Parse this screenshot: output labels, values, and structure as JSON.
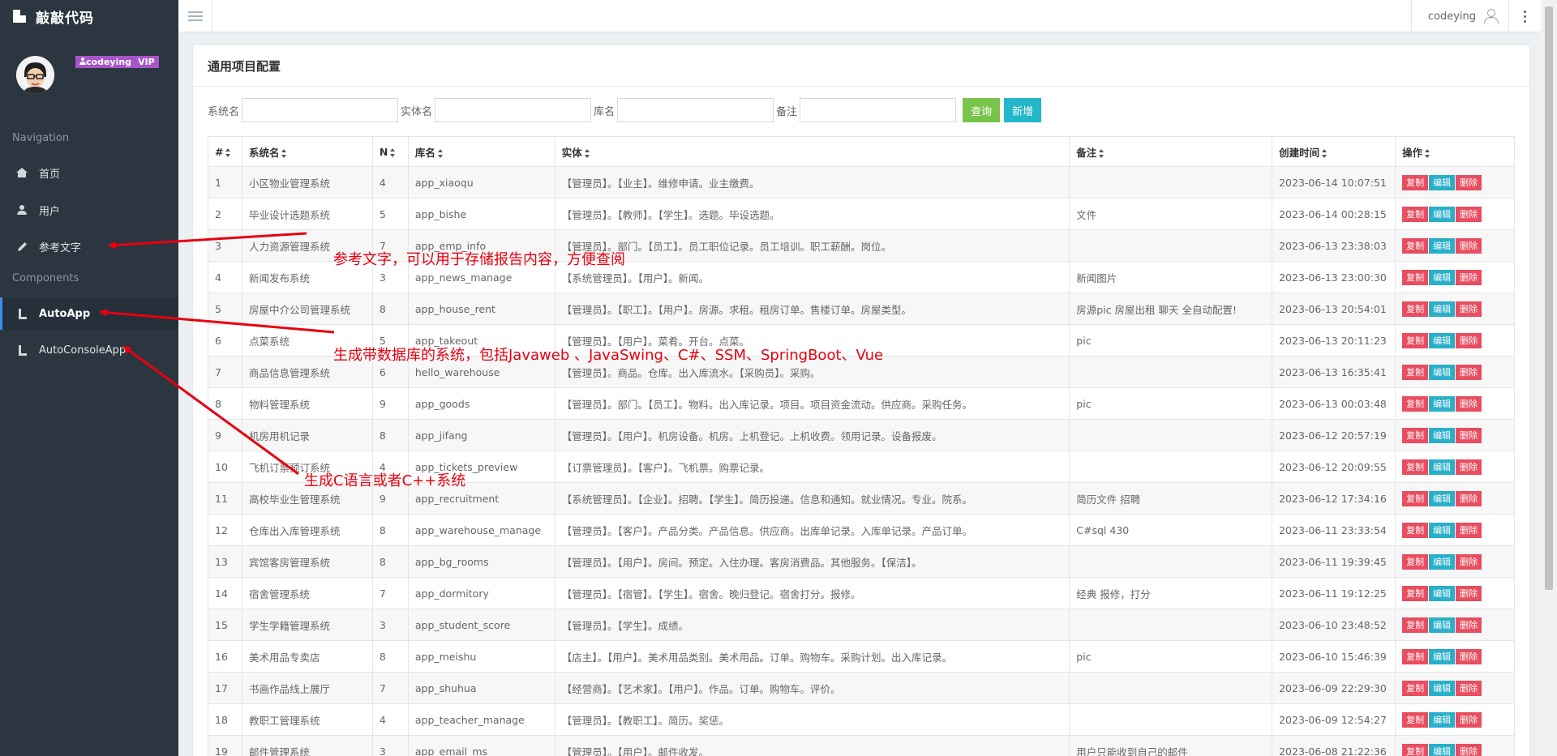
{
  "brand": {
    "title": "敲敲代码"
  },
  "profile": {
    "username": "codeying",
    "badge_tag": "VIP"
  },
  "sidebar": {
    "section_navigation": "Navigation",
    "section_components": "Components",
    "items": [
      {
        "label": "首页",
        "icon": "home-icon"
      },
      {
        "label": "用户",
        "icon": "user-icon"
      },
      {
        "label": "参考文字",
        "icon": "pencil-icon"
      },
      {
        "label": "AutoApp",
        "icon": "boot-icon",
        "active": true
      },
      {
        "label": "AutoConsoleApp",
        "icon": "boot-icon"
      }
    ]
  },
  "topbar": {
    "username": "codeying"
  },
  "panel": {
    "title": "通用项目配置"
  },
  "filter": {
    "system_label": "系统名",
    "entity_label": "实体名",
    "db_label": "库名",
    "remark_label": "备注",
    "query_button": "查询",
    "add_button": "新增"
  },
  "table": {
    "headers": [
      "#",
      "系统名",
      "N",
      "库名",
      "实体",
      "备注",
      "创建时间",
      "操作"
    ],
    "actions": {
      "copy": "复制",
      "edit": "编辑",
      "delete": "删除"
    },
    "rows": [
      [
        "1",
        "小区物业管理系统",
        "4",
        "app_xiaoqu",
        "【管理员】。【业主】。维修申请。业主缴费。",
        "",
        "2023-06-14 10:07:51"
      ],
      [
        "2",
        "毕业设计选题系统",
        "5",
        "app_bishe",
        "【管理员】。【教师】。【学生】。选题。毕设选题。",
        "文件",
        "2023-06-14 00:28:15"
      ],
      [
        "3",
        "人力资源管理系统",
        "7",
        "app_emp_info",
        "【管理员】。部门。【员工】。员工职位记录。员工培训。职工薪酬。岗位。",
        "",
        "2023-06-13 23:38:03"
      ],
      [
        "4",
        "新闻发布系统",
        "3",
        "app_news_manage",
        "【系统管理员】。【用户】。新闻。",
        "新闻图片",
        "2023-06-13 23:00:30"
      ],
      [
        "5",
        "房屋中介公司管理系统",
        "8",
        "app_house_rent",
        "【管理员】。【职工】。【用户】。房源。求租。租房订单。售楼订单。房屋类型。",
        "房源pic 房屋出租 聊天 全自动配置!",
        "2023-06-13 20:54:01"
      ],
      [
        "6",
        "点菜系统",
        "5",
        "app_takeout",
        "【管理员】。【用户】。菜肴。开台。点菜。",
        "pic",
        "2023-06-13 20:11:23"
      ],
      [
        "7",
        "商品信息管理系统",
        "6",
        "hello_warehouse",
        "【管理员】。商品。仓库。出入库流水。【采购员】。采购。",
        "",
        "2023-06-13 16:35:41"
      ],
      [
        "8",
        "物料管理系统",
        "9",
        "app_goods",
        "【管理员】。部门。【员工】。物料。出入库记录。项目。项目资金流动。供应商。采购任务。",
        "pic",
        "2023-06-13 00:03:48"
      ],
      [
        "9",
        "机房用机记录",
        "8",
        "app_jifang",
        "【管理员】。【用户】。机房设备。机房。上机登记。上机收费。领用记录。设备报废。",
        "",
        "2023-06-12 20:57:19"
      ],
      [
        "10",
        "飞机订票预订系统",
        "4",
        "app_tickets_preview",
        "【订票管理员】。【客户】。飞机票。购票记录。",
        "",
        "2023-06-12 20:09:55"
      ],
      [
        "11",
        "高校毕业生管理系统",
        "9",
        "app_recruitment",
        "【系统管理员】。【企业】。招聘。【学生】。简历投递。信息和通知。就业情况。专业。院系。",
        "简历文件 招聘",
        "2023-06-12 17:34:16"
      ],
      [
        "12",
        "仓库出入库管理系统",
        "8",
        "app_warehouse_manage",
        "【管理员】。【客户】。产品分类。产品信息。供应商。出库单记录。入库单记录。产品订单。",
        "C#sql 430",
        "2023-06-11 23:33:54"
      ],
      [
        "13",
        "宾馆客房管理系统",
        "8",
        "app_bg_rooms",
        "【管理员】。【用户】。房间。预定。入住办理。客房消费品。其他服务。【保洁】。",
        "",
        "2023-06-11 19:39:45"
      ],
      [
        "14",
        "宿舍管理系统",
        "7",
        "app_dormitory",
        "【管理员】。【宿管】。【学生】。宿舍。晚归登记。宿舍打分。报修。",
        "经典 报修，打分",
        "2023-06-11 19:12:25"
      ],
      [
        "15",
        "学生学籍管理系统",
        "3",
        "app_student_score",
        "【管理员】。【学生】。成绩。",
        "",
        "2023-06-10 23:48:52"
      ],
      [
        "16",
        "美术用品专卖店",
        "8",
        "app_meishu",
        "【店主】。【用户】。美术用品类别。美术用品。订单。购物车。采购计划。出入库记录。",
        "pic",
        "2023-06-10 15:46:39"
      ],
      [
        "17",
        "书画作品线上展厅",
        "7",
        "app_shuhua",
        "【经营商】。【艺术家】。【用户】。作品。订单。购物车。评价。",
        "",
        "2023-06-09 22:29:30"
      ],
      [
        "18",
        "教职工管理系统",
        "4",
        "app_teacher_manage",
        "【管理员】。【教职工】。简历。奖惩。",
        "",
        "2023-06-09 12:54:27"
      ],
      [
        "19",
        "邮件管理系统",
        "3",
        "app_email_ms",
        "【管理员】。【用户】。邮件收发。",
        "用户只能收到自己的邮件",
        "2023-06-08 21:22:36"
      ]
    ]
  },
  "annotations": {
    "a1": "参考文字，可以用于存储报告内容，方便查阅",
    "a2": "生成带数据库的系统，包括Javaweb 、JavaSwing、C#、SSM、SpringBoot、Vue",
    "a3": "生成C语言或者C++系统",
    "color": "#e8000f"
  }
}
